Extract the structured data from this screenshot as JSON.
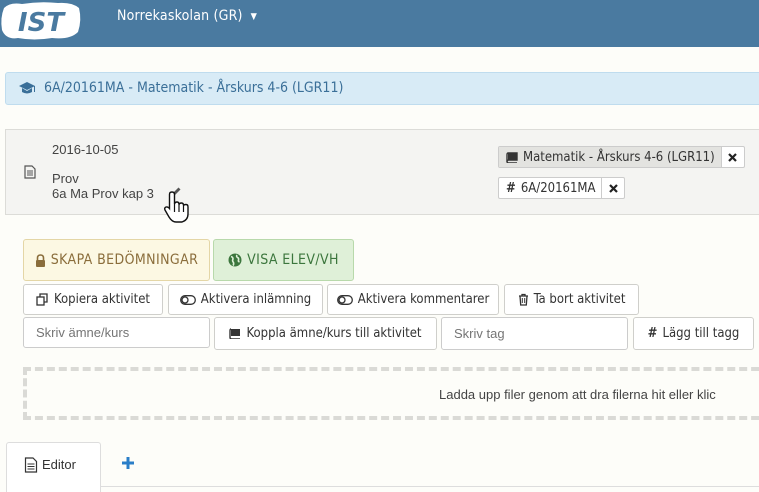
{
  "header": {
    "logo_text": "IST",
    "school_name": "Norrekaskolan (GR)"
  },
  "course_banner": {
    "title": "6A/20161MA - Matematik - Årskurs 4-6 (LGR11)"
  },
  "activity": {
    "date": "2016-10-05",
    "type": "Prov",
    "title": "6a Ma Prov kap 3",
    "tags": [
      {
        "label": "Matematik - Årskurs 4-6 (LGR11)",
        "kind": "subject"
      },
      {
        "label": "6A/20161MA",
        "kind": "hashtag"
      }
    ]
  },
  "actions": {
    "create_assessments": "SKAPA BEDÖMNINGAR",
    "show_students": "VISA ELEV/VH",
    "copy_activity": "Kopiera aktivitet",
    "enable_submission": "Aktivera inlämning",
    "enable_comments": "Aktivera kommentarer",
    "delete_activity": "Ta bort aktivitet",
    "subject_placeholder": "Skriv ämne/kurs",
    "link_subject": "Koppla ämne/kurs till aktivitet",
    "tag_placeholder": "Skriv tag",
    "add_tag": "Lägg till tagg"
  },
  "upload": {
    "text": "Ladda upp filer genom att dra filerna hit eller klic"
  },
  "tabs": {
    "editor": "Editor"
  },
  "colors": {
    "header_bg": "#4a7aa0",
    "banner_bg": "#d8ebf6",
    "banner_text": "#3a6f98",
    "warning_bg": "#fcf8e3",
    "success_bg": "#dff0d8",
    "accent_blue": "#2a7ec8"
  }
}
